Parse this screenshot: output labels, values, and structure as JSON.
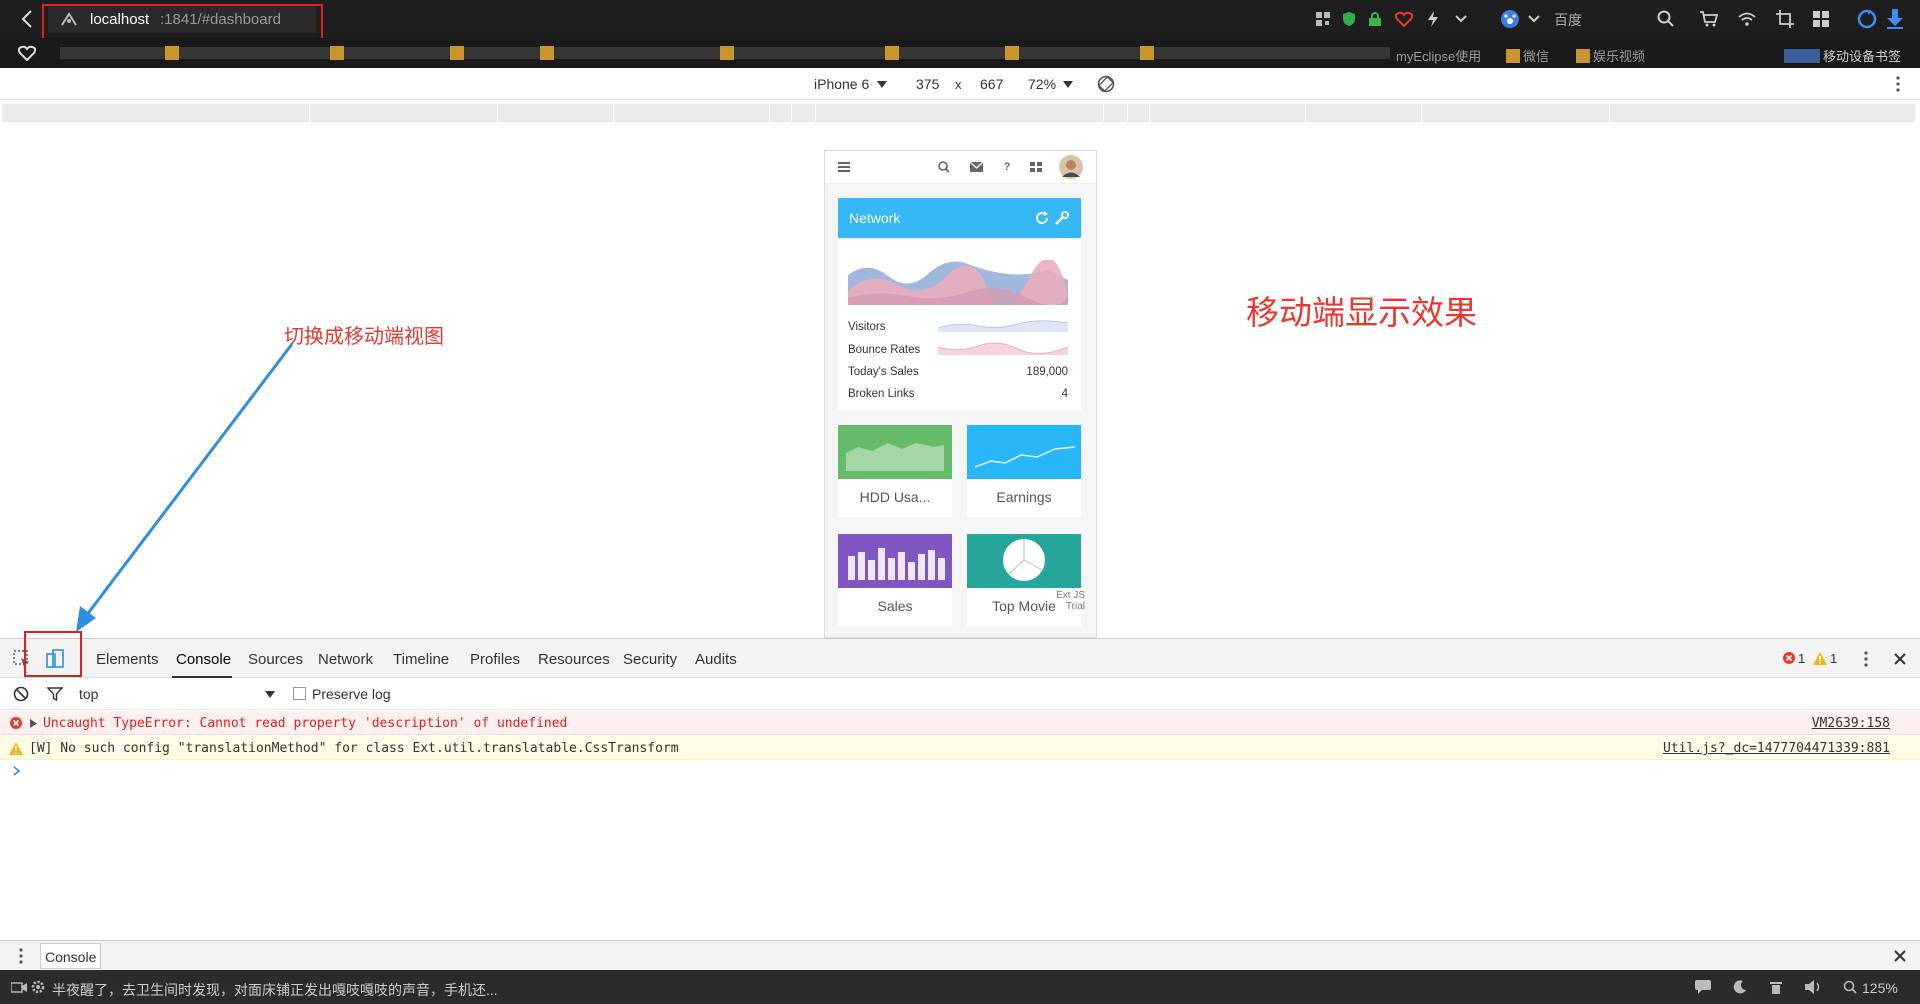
{
  "browser": {
    "url_host": "localhost",
    "url_rest": ":1841/#dashboard",
    "search_engine": "百度",
    "bookmark_bar_end": "移动设备书签",
    "bookmarks": [
      "myEclipse使用",
      "微信",
      "娱乐视频"
    ]
  },
  "emulation": {
    "device": "iPhone 6",
    "width": "375",
    "times": "x",
    "height": "667",
    "zoom": "72%"
  },
  "app": {
    "network_title": "Network",
    "rows": [
      {
        "label": "Visitors",
        "value": ""
      },
      {
        "label": "Bounce Rates",
        "value": ""
      },
      {
        "label": "Today's Sales",
        "value": "189,000"
      },
      {
        "label": "Broken Links",
        "value": "4"
      }
    ],
    "tiles": [
      "HDD Usa...",
      "Earnings",
      "Sales",
      "Top Movie"
    ],
    "watermark_line1": "Ext JS",
    "watermark_line2": "Trial"
  },
  "annotations": {
    "switch_view": "切换成移动端视图",
    "mobile_effect": "移动端显示效果"
  },
  "devtools": {
    "tabs": [
      "Elements",
      "Console",
      "Sources",
      "Network",
      "Timeline",
      "Profiles",
      "Resources",
      "Security",
      "Audits"
    ],
    "active_tab": "Console",
    "error_count": "1",
    "warning_count": "1",
    "context": "top",
    "preserve_log": "Preserve log",
    "messages": [
      {
        "level": "error",
        "text": "Uncaught TypeError: Cannot read property 'description' of undefined",
        "source": "VM2639:158"
      },
      {
        "level": "warning",
        "text": "[W] No such config \"translationMethod\" for class Ext.util.translatable.CssTransform",
        "source": "Util.js?_dc=1477704471339:881"
      }
    ],
    "drawer_tab": "Console"
  },
  "statusbar": {
    "news": "半夜醒了，去卫生间时发现，对面床铺正发出嘎吱嘎吱的声音，手机还...",
    "zoom": "125%"
  },
  "colors": {
    "header_blue": "#35b8f5",
    "hdd_green": "#66bb6a",
    "earnings_blue": "#29b6f6",
    "sales_purple": "#7e57c2",
    "movie_teal": "#26a69a",
    "annotation_red": "#e8382f",
    "arrow_blue": "#2e8fe0"
  }
}
